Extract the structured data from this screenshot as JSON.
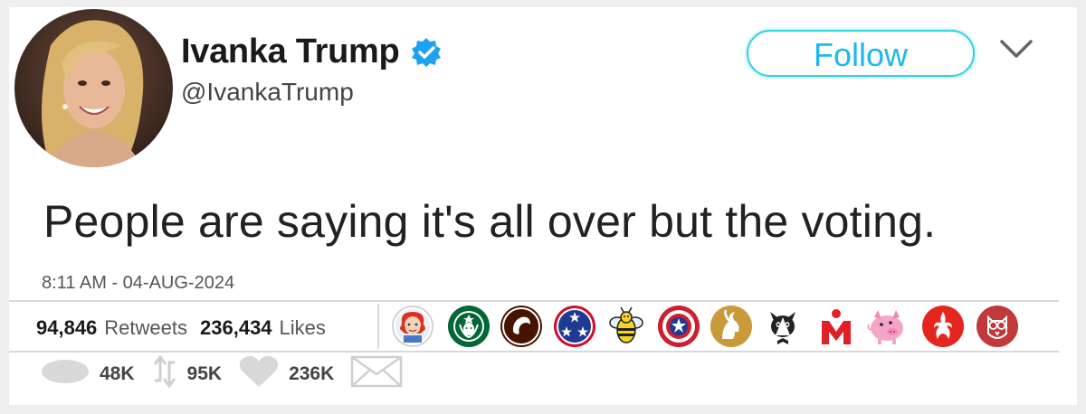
{
  "user": {
    "display_name": "Ivanka Trump",
    "handle": "@IvankaTrump",
    "verified": true
  },
  "follow_label": "Follow",
  "tweet": {
    "text": "People are saying it's all over but the voting.",
    "timestamp": "8:11 AM - 04-AUG-2024"
  },
  "stats": {
    "retweets_count": "94,846",
    "retweets_label": "Retweets",
    "likes_count": "236,434",
    "likes_label": "Likes"
  },
  "actions": {
    "replies": "48K",
    "retweets": "95K",
    "likes": "236K"
  },
  "colors": {
    "accent": "#1da1f2",
    "follow_border": "#31d2e3",
    "divider": "#d8d8d8"
  },
  "liker_badges": [
    "wendys-badge-icon",
    "starbucks-badge-icon",
    "chipotle-badge-icon",
    "tennessee-stars-badge-icon",
    "bee-badge-icon",
    "captain-america-shield-icon",
    "goat-badge-icon",
    "tuxedo-cat-badge-icon",
    "ironman-m-dot-icon",
    "pig-badge-icon",
    "rebel-alliance-icon",
    "owl-badge-icon"
  ]
}
